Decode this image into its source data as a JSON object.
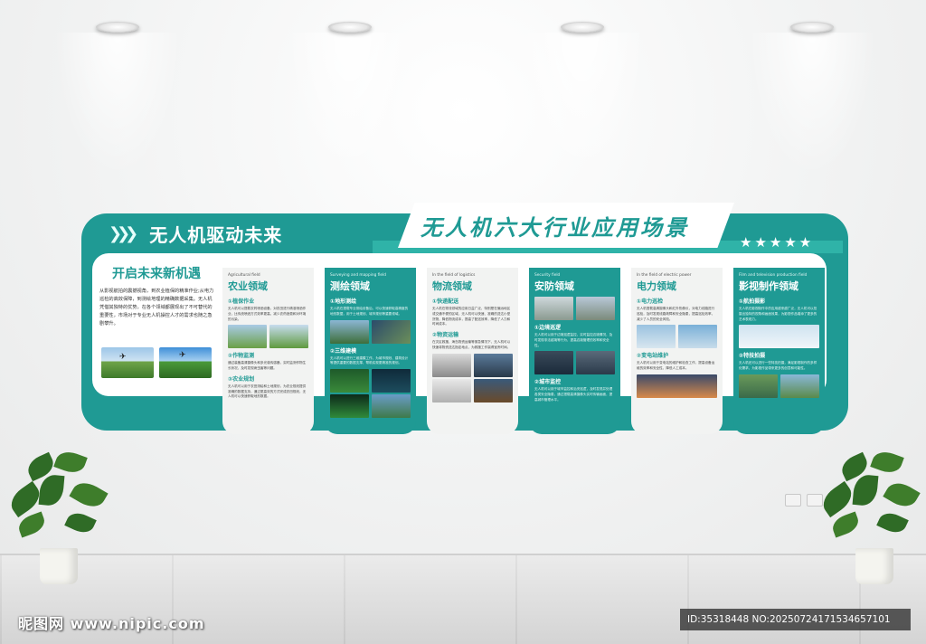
{
  "header": {
    "left_title": "无人机驱动未来",
    "main_title": "无人机六大行业应用场景",
    "chevrons": "❯❯❯",
    "stars": "★★★★★"
  },
  "intro": {
    "title": "开启未来新机遇",
    "text": "从影视航拍的震撼视角，到农业植保的精准作业;从电力巡检的高效保障，到测绘地理的精确数据采集。无人机凭借其独特的优势，在各个领域都展现出了不可替代的重要性，市场对于专业无人机操控人才的需求也随之急剧攀升。"
  },
  "panels": [
    {
      "subtitle": "Agricultural field",
      "title": "农业领域",
      "sections": [
        {
          "heading": "①植保作业",
          "text": "无人机可以搭载农药喷洒设备，对农田进行精准喷洒作业，比传统喷洒方式效率更高，减少农药浪费和对环境的污染。"
        },
        {
          "heading": "②作物监测",
          "text": "通过装备高清摄像头和多光谱传感器，实时监测作物生长状况，及时发现病虫害等问题。"
        },
        {
          "heading": "③农业规划",
          "text": "无人机可以用于农田测绘和土地规划，为农业规划提供准确的数据支持，通过更高效的方式完成农田规划，无人机可以快速获取地形数据。"
        }
      ]
    },
    {
      "subtitle": "Surveying and mapping field",
      "title": "测绘领域",
      "sections": [
        {
          "heading": "①地形测绘",
          "text": "无人机在搭载专业测绘设备后，可以快速获取高精度的地形数据，用于土地规划、城市规划等重要领域。"
        },
        {
          "heading": "②三维建模",
          "text": "无人机可以进行三维建模工作，为城市规划、建筑设计等提供重要的数据支撑，帮助实现更精准的规划。"
        }
      ]
    },
    {
      "subtitle": "In the field of logistics",
      "title": "物流领域",
      "sections": [
        {
          "heading": "①快递配送",
          "text": "无人机在物流领域的应用日益广泛，特别是在偏远地区或交通不便的区域，无人机可以快速、准确的送达小型货物，降低物流成本，提高了配送效率，降低了人力和时间成本。"
        },
        {
          "heading": "②物资运输",
          "text": "在灾区救援、海岛物资运输等紧急情况下，无人机可以快速将物资送达指定地点，为救援工作赢得宝贵时间。"
        }
      ]
    },
    {
      "subtitle": "Security field",
      "title": "安防领域",
      "sections": [
        {
          "heading": "①边境巡逻",
          "text": "无人机可以用于边境巡逻监控，实时监控边境情况，及时发现非法越境等行为，提高边境管理的效率和安全性。"
        },
        {
          "heading": "②城市监控",
          "text": "无人机可以用于城市监控和治安巡逻，及时发现并处理各类安全隐患，通过搭载高清摄像头实时传输画面，提高城市管理水平。"
        }
      ]
    },
    {
      "subtitle": "In the field of electric power",
      "title": "电力领域",
      "sections": [
        {
          "heading": "①电力巡检",
          "text": "无人机搭载高清摄像头和红外热像仪，对电力线路进行巡检，及时发现线路故障和安全隐患，提高巡检效率，减少了人员的安全风险。"
        },
        {
          "heading": "②变电站维护",
          "text": "无人机可以用于变电站的维护和检查工作，提高设备运维的效率和安全性，降低人工成本。"
        }
      ]
    },
    {
      "subtitle": "Film and television production field",
      "title": "影视制作领域",
      "sections": [
        {
          "heading": "①航拍摄影",
          "text": "无人机在影视制作中的应用越来越广泛，无人机可以拍摄出独特的视角和画面效果，为影视作品增添了更多的艺术表现力。"
        },
        {
          "heading": "②特技拍摄",
          "text": "无人机还可以进行一些特技拍摄，满足影视制作的多样化需求，为影视作品带来更多的创意和可能性。"
        }
      ]
    }
  ],
  "watermark": {
    "site": "昵图网 www.nipic.com",
    "id_text": "ID:35318448 NO:20250724171534657101"
  },
  "colors": {
    "teal": "#1f9a94",
    "teal_light": "#2fb3a8",
    "panel_light": "#f2f3f2"
  }
}
